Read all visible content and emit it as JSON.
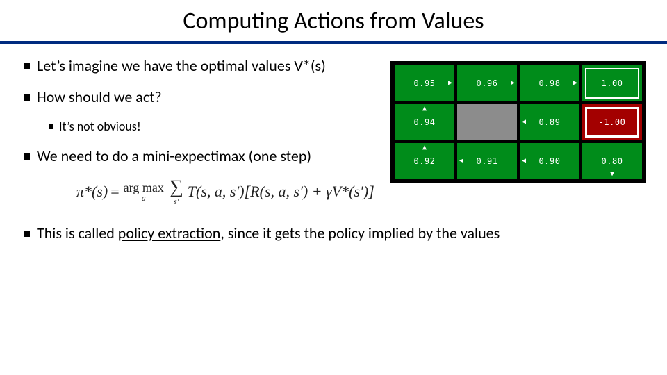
{
  "title": "Computing Actions from Values",
  "bullets": {
    "b1": "Let’s imagine we have the optimal values V*(s)",
    "b2": "How should we act?",
    "b2a": "It’s not obvious!",
    "b3": "We need to do a mini-expectimax (one step)",
    "b4_pre": "This is called ",
    "b4_u": "policy extraction",
    "b4_post": ", since it gets the policy implied by the values"
  },
  "formula": {
    "lhs": "π*(s)",
    "eq": " = ",
    "argmax_op": "arg max",
    "argmax_sub": "a",
    "sigma": "∑",
    "sigma_sub": "s′",
    "body": "T(s, a, s′)[R(s, a, s′) + γV*(s′)]"
  },
  "grid": {
    "r0c0": "0.95",
    "r0c1": "0.96",
    "r0c2": "0.98",
    "r0c3": "1.00",
    "r1c0": "0.94",
    "r1c2": "0.89",
    "r1c3": "-1.00",
    "r2c0": "0.92",
    "r2c1": "0.91",
    "r2c2": "0.90",
    "r2c3": "0.80",
    "arrows": {
      "r0c0": "right",
      "r0c1": "right",
      "r0c2": "right",
      "r1c0": "up",
      "r1c2": "left",
      "r2c0": "up",
      "r2c1": "left",
      "r2c2": "left",
      "r2c3": "down"
    }
  }
}
